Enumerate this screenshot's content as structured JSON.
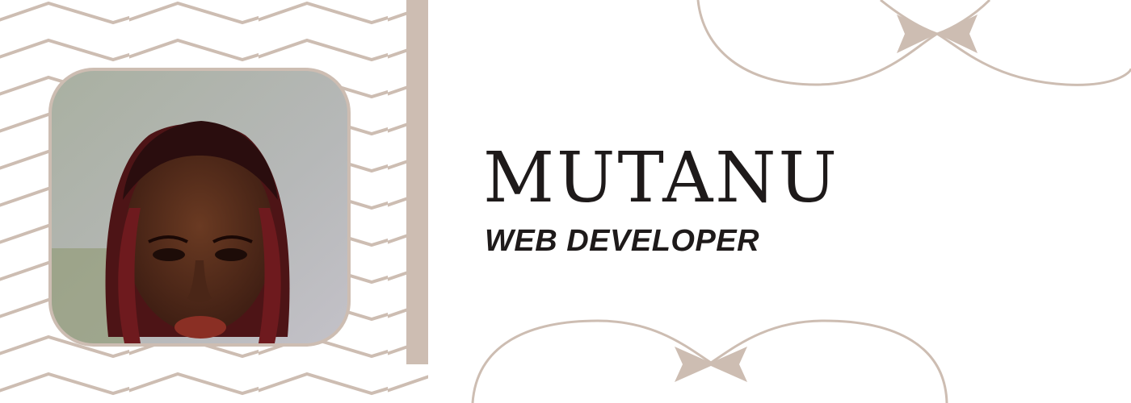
{
  "profile": {
    "name": "MUTANU",
    "role": "WEB DEVELOPER",
    "photo_icon": "portrait-photo"
  },
  "theme": {
    "accent": "#cdbdb2",
    "text": "#1e1a1a",
    "background": "#ffffff"
  }
}
